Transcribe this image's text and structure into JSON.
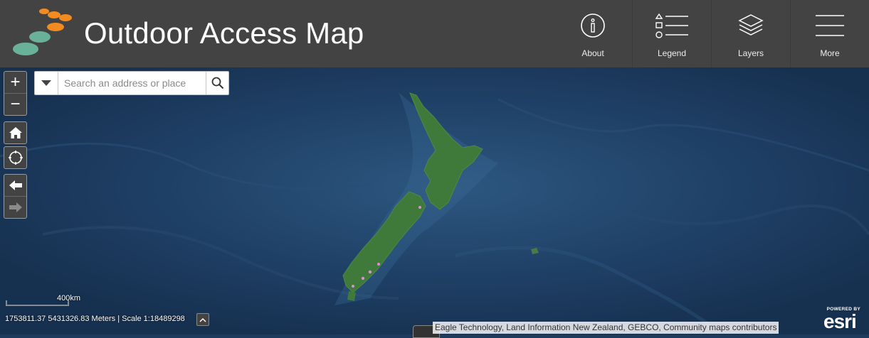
{
  "header": {
    "title": "Outdoor Access Map",
    "logo_colors": [
      "#f28b20",
      "#6ab19a"
    ],
    "nav": [
      {
        "label": "About",
        "icon": "info-icon"
      },
      {
        "label": "Legend",
        "icon": "legend-icon"
      },
      {
        "label": "Layers",
        "icon": "layers-icon"
      },
      {
        "label": "More",
        "icon": "menu-icon"
      }
    ]
  },
  "controls": {
    "zoom_in": "+",
    "zoom_out": "−",
    "home_icon": "home-icon",
    "locate_icon": "locate-icon",
    "back_icon": "arrow-left-icon",
    "forward_icon": "arrow-right-icon"
  },
  "search": {
    "placeholder": "Search an address or place",
    "value": ""
  },
  "map": {
    "scale_label": "400km",
    "coordinates": "1753811.37 5431326.83 Meters | Scale 1:18489298",
    "attribution": "Eagle Technology, Land Information New Zealand, GEBCO, Community maps contributors",
    "powered_by": "POWERED BY",
    "brand": "esri"
  },
  "colors": {
    "header_bg": "#444343",
    "ocean": "#1e3a5c",
    "land": "#3f7a3a"
  }
}
